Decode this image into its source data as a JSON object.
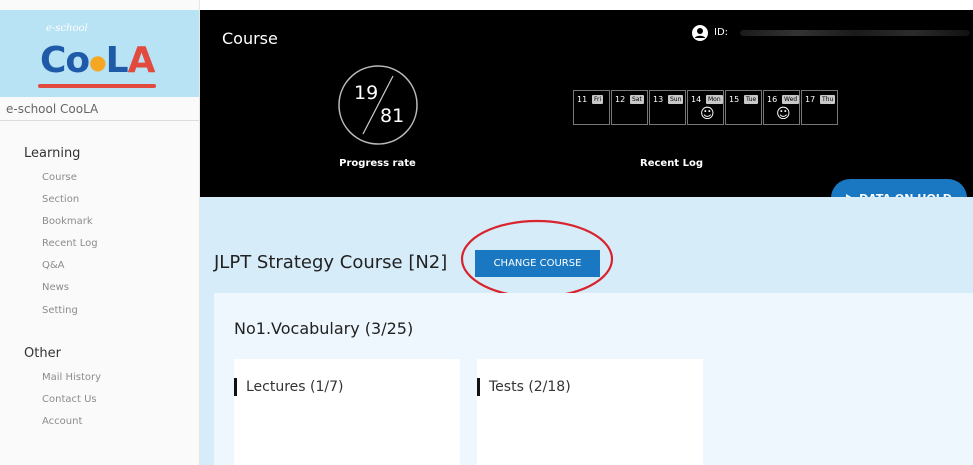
{
  "sidebar": {
    "logo_small": "e-school",
    "logo_main": "CooLA",
    "school_name": "e-school CooLA",
    "sections": [
      {
        "title": "Learning",
        "items": [
          "Course",
          "Section",
          "Bookmark",
          "Recent Log",
          "Q&A",
          "News",
          "Setting"
        ]
      },
      {
        "title": "Other",
        "items": [
          "Mail History",
          "Contact Us",
          "Account"
        ]
      }
    ]
  },
  "header": {
    "title": "Course",
    "id_label": "ID:",
    "progress": {
      "done": "19",
      "total": "81",
      "label": "Progress rate"
    },
    "recent_log": {
      "label": "Recent Log",
      "days": [
        {
          "num": "11",
          "dow": "Fri",
          "smile": ""
        },
        {
          "num": "12",
          "dow": "Sat",
          "smile": ""
        },
        {
          "num": "13",
          "dow": "Sun",
          "smile": ""
        },
        {
          "num": "14",
          "dow": "Mon",
          "smile": "☺"
        },
        {
          "num": "15",
          "dow": "Tue",
          "smile": ""
        },
        {
          "num": "16",
          "dow": "Wed",
          "smile": "☺"
        },
        {
          "num": "17",
          "dow": "Thu",
          "smile": ""
        }
      ]
    }
  },
  "hold_button": {
    "label": "DATA ON HOLD"
  },
  "main": {
    "course_title": "JLPT Strategy Course [N2]",
    "change_button": "CHANGE COURSE",
    "section_title": "No1.Vocabulary (3/25)",
    "cards": [
      {
        "label": "Lectures (1/7)"
      },
      {
        "label": "Tests (2/18)"
      }
    ]
  },
  "colors": {
    "header_bg": "#000000",
    "main_bg": "#d6ecf9",
    "accent_blue": "#1a78c2",
    "annotation_red": "#d9232d"
  }
}
